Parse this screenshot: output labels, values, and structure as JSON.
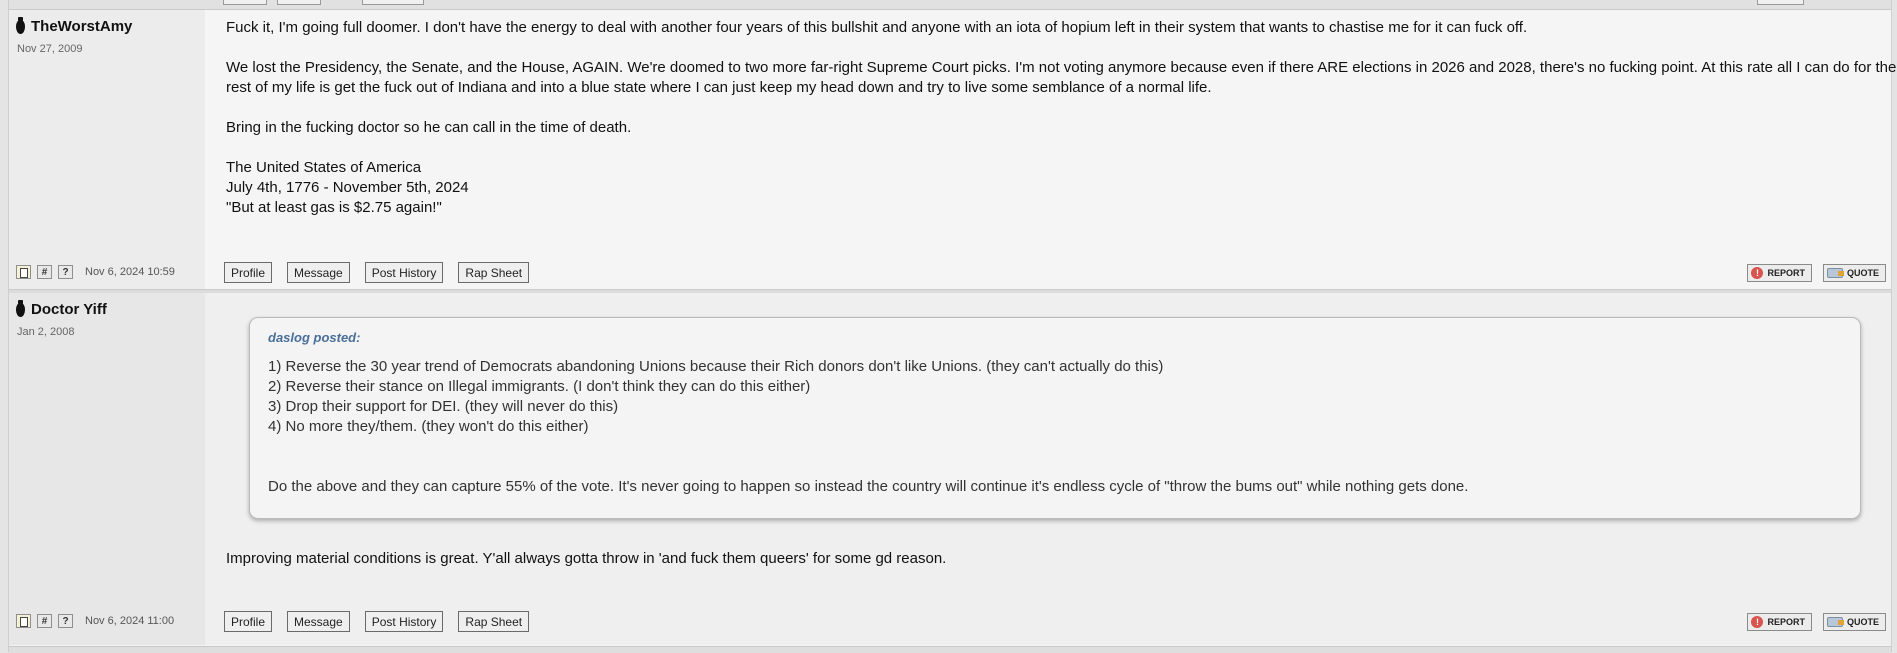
{
  "posts": [
    {
      "author": "TheWorstAmy",
      "reg_date": "Nov 27, 2009",
      "paragraphs": [
        [
          "Fuck it, I'm going full doomer. I don't have the energy to deal with another four years of this bullshit and anyone with an iota of hopium left in their system that wants to chastise me for it can fuck off."
        ],
        [
          "We lost the Presidency, the Senate, and the House, AGAIN. We're doomed to two more far-right Supreme Court picks. I'm not voting anymore because even if there ARE elections in 2026 and 2028, there's no fucking point. At this rate all I can do for the",
          "rest of my life is get the fuck out of Indiana and into a blue state where I can just keep my head down and try to live some semblance of a normal life."
        ],
        [
          "Bring in the fucking doctor so he can call in the time of death."
        ],
        [
          "The United States of America",
          "July 4th, 1776 - November 5th, 2024",
          "\"But at least gas is $2.75 again!\""
        ]
      ],
      "post_date": "Nov 6, 2024 10:59"
    },
    {
      "author": "Doctor Yiff",
      "reg_date": "Jan 2, 2008",
      "quote": {
        "header": "daslog posted:",
        "lines": [
          "1) Reverse the 30 year trend of Democrats abandoning Unions because their Rich donors don't like Unions. (they can't actually do this)",
          "2) Reverse their stance on Illegal immigrants. (I don't think they can do this either)",
          "3) Drop their support for DEI. (they will never do this)",
          "4) No more they/them. (they won't do this either)",
          "Do the above and they can capture 55% of the vote. It's never going to happen so instead the country will continue it's endless cycle of \"throw the bums out\" while nothing gets done."
        ]
      },
      "reply": "Improving material conditions is great. Y'all always gotta throw in 'and fuck them queers' for some gd reason.",
      "post_date": "Nov 6, 2024 11:00"
    }
  ],
  "footer": {
    "icon_hash": "#",
    "icon_question": "?",
    "buttons": [
      "Profile",
      "Message",
      "Post History",
      "Rap Sheet"
    ],
    "report_label": "REPORT",
    "quote_label": "QUOTE"
  }
}
